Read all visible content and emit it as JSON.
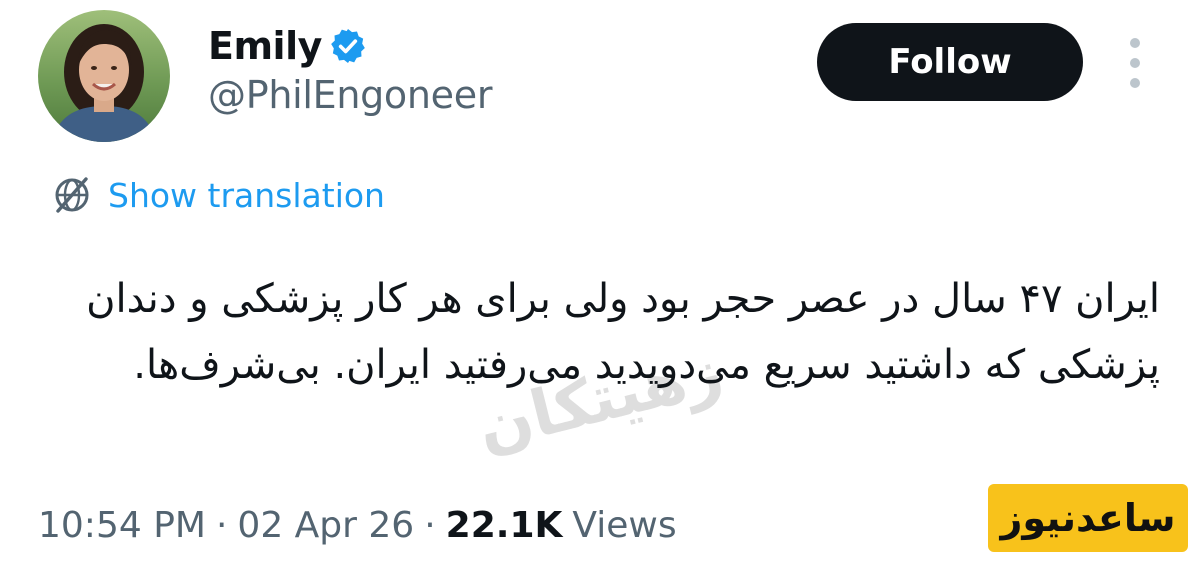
{
  "author": {
    "display_name": "Emily",
    "handle": "@PhilEngoneer",
    "verified": true,
    "avatar_icon": "profile-photo-icon"
  },
  "actions": {
    "follow_label": "Follow",
    "more_icon": "more-vertical-icon"
  },
  "translation": {
    "icon": "translate-globe-icon",
    "label": "Show translation"
  },
  "tweet": {
    "text": "ایران ۴۷ سال در عصر حجر بود ولی برای هر کار پزشکی و دندان پزشکی که داشتید سریع می‌دویدید می‌رفتید ایران. بی‌شرف‌ها."
  },
  "meta": {
    "time": "10:54 PM",
    "separator": "·",
    "date": "02 Apr 26",
    "views_count": "22.1K",
    "views_label": "Views"
  },
  "watermark": {
    "text": "زهیتکان"
  },
  "site_logo": {
    "text": "ساعدنیوز"
  },
  "colors": {
    "text_primary": "#0f1419",
    "text_secondary": "#536471",
    "link_blue": "#1d9bf0",
    "button_dark": "#0f1419",
    "logo_yellow": "#f8c21b"
  }
}
